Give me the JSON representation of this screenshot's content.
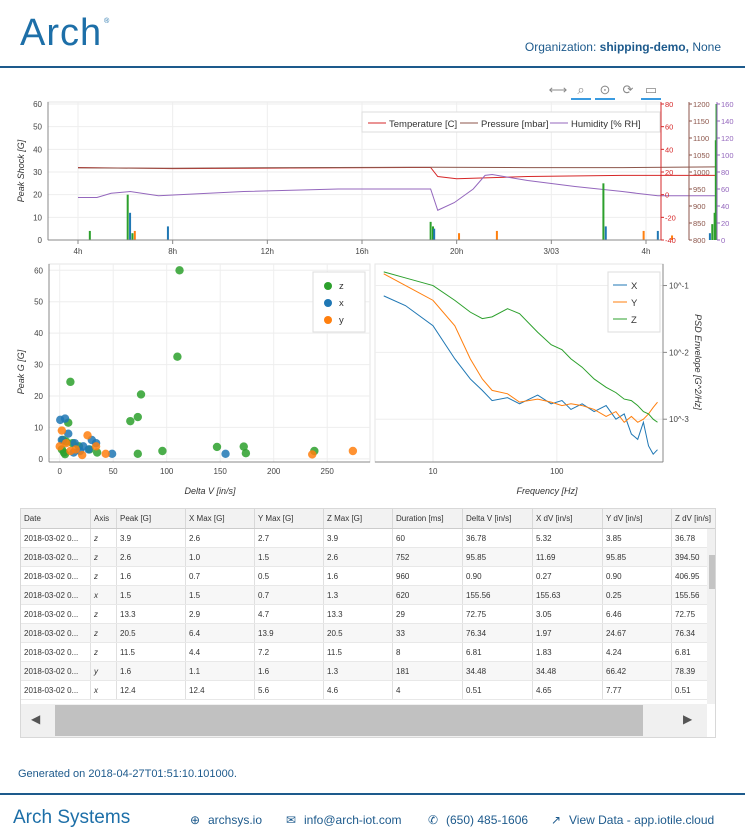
{
  "header": {
    "logo": "Arch",
    "logo_mark": "®",
    "org_label": "Organization:",
    "org_name": "shipping-demo,",
    "org_extra": "None"
  },
  "toolbar": {
    "icons": [
      "pan-icon",
      "box-zoom-icon",
      "wheel-zoom-icon",
      "reset-icon",
      "save-icon"
    ]
  },
  "colors": {
    "z": "#2ca02c",
    "x": "#1f77b4",
    "y": "#ff7f0e",
    "temperature": "#d62728",
    "pressure": "#8c564b",
    "humidity": "#9467bd"
  },
  "chart_data": [
    {
      "type": "bar",
      "id": "timeline",
      "ylabel": "Peak Shock [G]",
      "ylim": [
        0,
        60
      ],
      "yticks": [
        0,
        10,
        20,
        30,
        40,
        50,
        60
      ],
      "xticks": [
        "4h",
        "8h",
        "12h",
        "16h",
        "20h",
        "3/03",
        "4h"
      ],
      "series": [
        {
          "name": "z",
          "points": [
            [
              1.5,
              4
            ],
            [
              3.1,
              20
            ],
            [
              3.3,
              3
            ],
            [
              15.9,
              8
            ],
            [
              16.0,
              6
            ],
            [
              23.2,
              25
            ],
            [
              27.8,
              7
            ],
            [
              27.9,
              12
            ],
            [
              27.95,
              44
            ],
            [
              27.98,
              60
            ]
          ]
        },
        {
          "name": "x",
          "points": [
            [
              3.2,
              12
            ],
            [
              4.8,
              6
            ],
            [
              16.05,
              5
            ],
            [
              23.3,
              6
            ],
            [
              25.5,
              4
            ],
            [
              27.7,
              3
            ]
          ]
        },
        {
          "name": "y",
          "points": [
            [
              3.4,
              4
            ],
            [
              17.1,
              3
            ],
            [
              18.7,
              4
            ],
            [
              24.9,
              4
            ],
            [
              26.1,
              2
            ]
          ]
        }
      ],
      "environment": {
        "legend": [
          "Temperature [C]",
          "Pressure [mbar]",
          "Humidity [% RH]"
        ],
        "right_axes": [
          {
            "name": "temperature",
            "ylim": [
              -40,
              80
            ],
            "ticks": [
              -40,
              -20,
              0,
              20,
              40,
              60,
              80
            ]
          },
          {
            "name": "pressure",
            "ylim": [
              800,
              1200
            ],
            "ticks": [
              800,
              850,
              900,
              950,
              1000,
              1050,
              1100,
              1150,
              1200
            ]
          },
          {
            "name": "humidity",
            "ylim": [
              0,
              160
            ],
            "ticks": [
              0,
              20,
              40,
              60,
              80,
              100,
              120,
              140,
              160
            ]
          }
        ],
        "temperature": [
          [
            1,
            24
          ],
          [
            5,
            23
          ],
          [
            10,
            23.5
          ],
          [
            15,
            24
          ],
          [
            15.9,
            24
          ],
          [
            16.2,
            16
          ],
          [
            17,
            14
          ],
          [
            20,
            16
          ],
          [
            24,
            17
          ],
          [
            28,
            17
          ]
        ],
        "pressure": [
          [
            1,
            1012
          ],
          [
            5,
            1011
          ],
          [
            10,
            1013
          ],
          [
            15,
            1014
          ],
          [
            16,
            1014
          ],
          [
            20,
            1013
          ],
          [
            24,
            1013
          ],
          [
            28,
            1015
          ]
        ],
        "humidity": [
          [
            1,
            50
          ],
          [
            1.8,
            50
          ],
          [
            2.4,
            55
          ],
          [
            3.2,
            57
          ],
          [
            4.4,
            52
          ],
          [
            8,
            57
          ],
          [
            12,
            60
          ],
          [
            15,
            60
          ],
          [
            15.9,
            60
          ],
          [
            16.2,
            35
          ],
          [
            16.9,
            44
          ],
          [
            17.7,
            60
          ],
          [
            18.2,
            76
          ],
          [
            18.5,
            77
          ],
          [
            20,
            70
          ],
          [
            22,
            63
          ],
          [
            24,
            57
          ],
          [
            25.5,
            52
          ],
          [
            28,
            52
          ]
        ]
      }
    },
    {
      "type": "scatter",
      "id": "peak-vs-dv",
      "xlabel": "Delta V [in/s]",
      "ylabel": "Peak G [G]",
      "xlim": [
        -10,
        290
      ],
      "ylim": [
        -1,
        62
      ],
      "xticks": [
        0,
        50,
        100,
        150,
        200,
        250
      ],
      "yticks": [
        0,
        10,
        20,
        30,
        40,
        50,
        60
      ],
      "legend": [
        "z",
        "x",
        "y"
      ],
      "series": [
        {
          "name": "z",
          "points": [
            [
              112,
              60
            ],
            [
              110,
              32.5
            ],
            [
              10,
              24.5
            ],
            [
              76,
              20.5
            ],
            [
              73,
              13.3
            ],
            [
              66,
              12
            ],
            [
              3,
              6
            ],
            [
              6,
              5.5
            ],
            [
              8,
              11.5
            ],
            [
              2,
              3
            ],
            [
              4,
              2
            ],
            [
              28,
              3
            ],
            [
              35,
              2
            ],
            [
              96,
              2.5
            ],
            [
              73,
              1.6
            ],
            [
              147,
              3.8
            ],
            [
              172,
              3.9
            ],
            [
              174,
              1.8
            ],
            [
              238,
              2.5
            ],
            [
              5,
              1.5
            ],
            [
              12,
              5
            ],
            [
              18,
              4
            ]
          ]
        },
        {
          "name": "x",
          "points": [
            [
              0.5,
              12.4
            ],
            [
              5,
              12.8
            ],
            [
              8,
              8
            ],
            [
              2,
              6
            ],
            [
              14,
              5
            ],
            [
              19,
              2.5
            ],
            [
              30,
              6
            ],
            [
              34,
              5
            ],
            [
              49,
              1.6
            ],
            [
              155,
              1.6
            ],
            [
              13,
              2
            ],
            [
              22,
              4
            ],
            [
              27,
              3
            ]
          ]
        },
        {
          "name": "y",
          "points": [
            [
              2,
              9
            ],
            [
              26,
              7.5
            ],
            [
              34,
              4
            ],
            [
              6,
              5
            ],
            [
              15,
              3
            ],
            [
              43,
              1.6
            ],
            [
              236,
              1.4
            ],
            [
              274,
              2.5
            ],
            [
              10,
              2.5
            ],
            [
              21,
              1.2
            ],
            [
              0,
              4
            ]
          ]
        }
      ]
    },
    {
      "type": "line",
      "id": "psd",
      "xlabel": "Frequency [Hz]",
      "ylabel": "PSD Envelope [G^2/Hz]",
      "xscale": "log",
      "yscale": "log",
      "xlim": [
        3.4,
        720
      ],
      "ylim": [
        0.000229,
        0.21
      ],
      "xticks": [
        10,
        100
      ],
      "yticks_labels": [
        "10^-1",
        "10^-2",
        "10^-3"
      ],
      "legend": [
        "X",
        "Y",
        "Z"
      ],
      "series": [
        {
          "name": "X",
          "points": [
            [
              4,
              0.07
            ],
            [
              6,
              0.05
            ],
            [
              10,
              0.025
            ],
            [
              15,
              0.008
            ],
            [
              20,
              0.004
            ],
            [
              25,
              0.0027
            ],
            [
              30,
              0.0019
            ],
            [
              40,
              0.0021
            ],
            [
              50,
              0.0017
            ],
            [
              70,
              0.0023
            ],
            [
              90,
              0.0017
            ],
            [
              110,
              0.0019
            ],
            [
              130,
              0.0014
            ],
            [
              160,
              0.0017
            ],
            [
              200,
              0.0013
            ],
            [
              250,
              0.0016
            ],
            [
              300,
              0.001
            ],
            [
              350,
              0.0012
            ],
            [
              400,
              0.0006
            ],
            [
              450,
              0.0005
            ],
            [
              500,
              0.0009
            ],
            [
              550,
              0.0004
            ],
            [
              600,
              0.0003
            ],
            [
              650,
              0.00035
            ]
          ]
        },
        {
          "name": "Y",
          "points": [
            [
              4,
              0.15
            ],
            [
              6,
              0.1
            ],
            [
              10,
              0.06
            ],
            [
              15,
              0.025
            ],
            [
              20,
              0.008
            ],
            [
              25,
              0.004
            ],
            [
              30,
              0.0027
            ],
            [
              40,
              0.0024
            ],
            [
              50,
              0.0018
            ],
            [
              70,
              0.002
            ],
            [
              90,
              0.0018
            ],
            [
              110,
              0.0016
            ],
            [
              130,
              0.0017
            ],
            [
              160,
              0.0016
            ],
            [
              200,
              0.0014
            ],
            [
              250,
              0.0011
            ],
            [
              300,
              0.0013
            ],
            [
              350,
              0.0009
            ],
            [
              400,
              0.0011
            ],
            [
              450,
              0.0009
            ],
            [
              500,
              0.001
            ],
            [
              550,
              0.0012
            ],
            [
              600,
              0.0015
            ],
            [
              650,
              0.0018
            ]
          ]
        },
        {
          "name": "Z",
          "points": [
            [
              4,
              0.16
            ],
            [
              6,
              0.13
            ],
            [
              10,
              0.1
            ],
            [
              15,
              0.06
            ],
            [
              20,
              0.04
            ],
            [
              25,
              0.032
            ],
            [
              30,
              0.034
            ],
            [
              40,
              0.045
            ],
            [
              50,
              0.038
            ],
            [
              70,
              0.02
            ],
            [
              90,
              0.013
            ],
            [
              110,
              0.011
            ],
            [
              130,
              0.008
            ],
            [
              160,
              0.006
            ],
            [
              200,
              0.004
            ],
            [
              250,
              0.003
            ],
            [
              300,
              0.0025
            ],
            [
              350,
              0.002
            ],
            [
              400,
              0.0019
            ],
            [
              450,
              0.0016
            ],
            [
              500,
              0.0013
            ],
            [
              550,
              0.0012
            ],
            [
              600,
              0.001
            ],
            [
              650,
              0.0009
            ]
          ]
        }
      ]
    }
  ],
  "table": {
    "columns": [
      "Date",
      "Axis",
      "Peak [G]",
      "X Max [G]",
      "Y Max [G]",
      "Z Max [G]",
      "Duration [ms]",
      "Delta V [in/s]",
      "X dV [in/s]",
      "Y dV [in/s]",
      "Z dV [in/s]"
    ],
    "rows": [
      [
        "2018-03-02 0...",
        "z",
        "3.9",
        "2.6",
        "2.7",
        "3.9",
        "60",
        "36.78",
        "5.32",
        "3.85",
        "36.78"
      ],
      [
        "2018-03-02 0...",
        "z",
        "2.6",
        "1.0",
        "1.5",
        "2.6",
        "752",
        "95.85",
        "11.69",
        "95.85",
        "394.50"
      ],
      [
        "2018-03-02 0...",
        "z",
        "1.6",
        "0.7",
        "0.5",
        "1.6",
        "960",
        "0.90",
        "0.27",
        "0.90",
        "406.95"
      ],
      [
        "2018-03-02 0...",
        "x",
        "1.5",
        "1.5",
        "0.7",
        "1.3",
        "620",
        "155.56",
        "155.63",
        "0.25",
        "155.56"
      ],
      [
        "2018-03-02 0...",
        "z",
        "13.3",
        "2.9",
        "4.7",
        "13.3",
        "29",
        "72.75",
        "3.05",
        "6.46",
        "72.75"
      ],
      [
        "2018-03-02 0...",
        "z",
        "20.5",
        "6.4",
        "13.9",
        "20.5",
        "33",
        "76.34",
        "1.97",
        "24.67",
        "76.34"
      ],
      [
        "2018-03-02 0...",
        "z",
        "11.5",
        "4.4",
        "7.2",
        "11.5",
        "8",
        "6.81",
        "1.83",
        "4.24",
        "6.81"
      ],
      [
        "2018-03-02 0...",
        "y",
        "1.6",
        "1.1",
        "1.6",
        "1.3",
        "181",
        "34.48",
        "34.48",
        "66.42",
        "78.39"
      ],
      [
        "2018-03-02 0...",
        "x",
        "12.4",
        "12.4",
        "5.6",
        "4.6",
        "4",
        "0.51",
        "4.65",
        "7.77",
        "0.51"
      ]
    ]
  },
  "generated": "Generated on 2018-04-27T01:51:10.101000.",
  "footer": {
    "logo_main": "Arch",
    "logo_sub": "Systems",
    "website": "archsys.io",
    "email": "info@arch-iot.com",
    "phone": "(650) 485-1606",
    "view_data": "View Data - app.iotile.cloud"
  }
}
